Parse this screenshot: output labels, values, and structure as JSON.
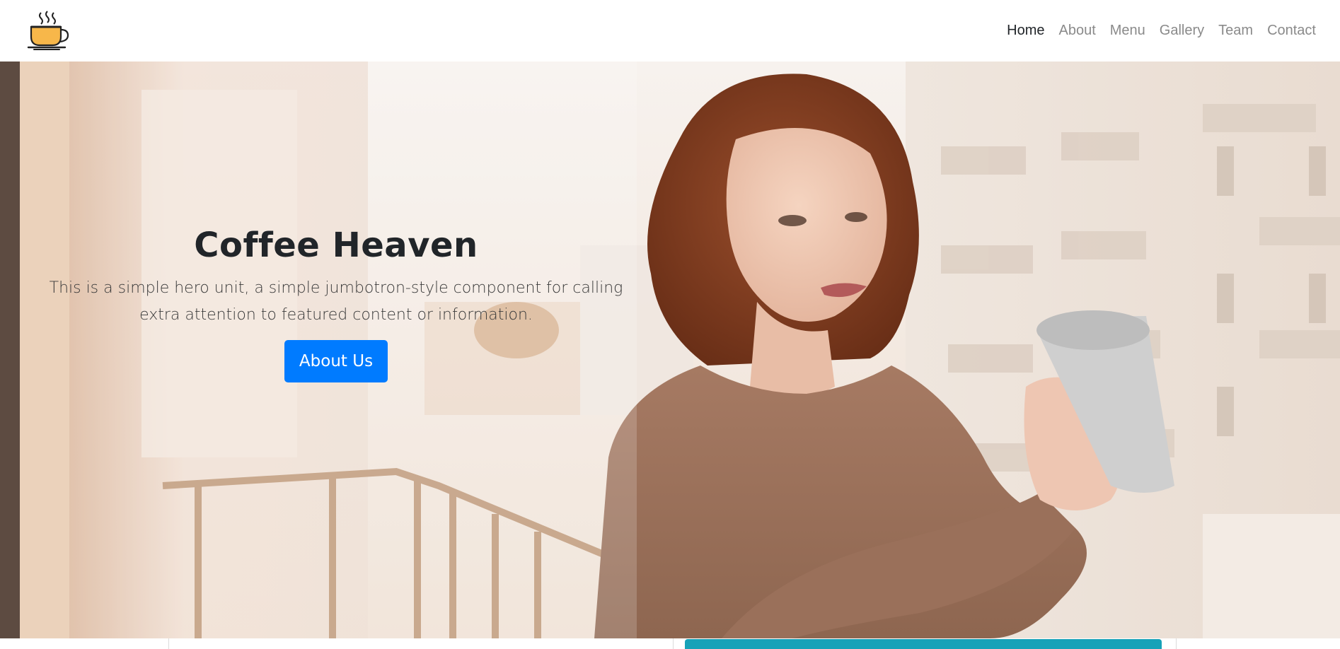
{
  "brand": {
    "logo_icon": "coffee-cup-icon"
  },
  "nav": {
    "items": [
      {
        "label": "Home",
        "active": true
      },
      {
        "label": "About",
        "active": false
      },
      {
        "label": "Menu",
        "active": false
      },
      {
        "label": "Gallery",
        "active": false
      },
      {
        "label": "Team",
        "active": false
      },
      {
        "label": "Contact",
        "active": false
      }
    ]
  },
  "hero": {
    "title": "Coffee Heaven",
    "lead": "This is a simple hero unit, a simple jumbotron-style component for calling extra attention to featured content or information.",
    "button_label": "About Us",
    "button_color": "#007bff",
    "image_subject": "woman holding coffee mug on balcony"
  },
  "colors": {
    "nav_active": "#212529",
    "nav_inactive": "#8a8a8a",
    "accent_teal": "#17a2b8"
  }
}
